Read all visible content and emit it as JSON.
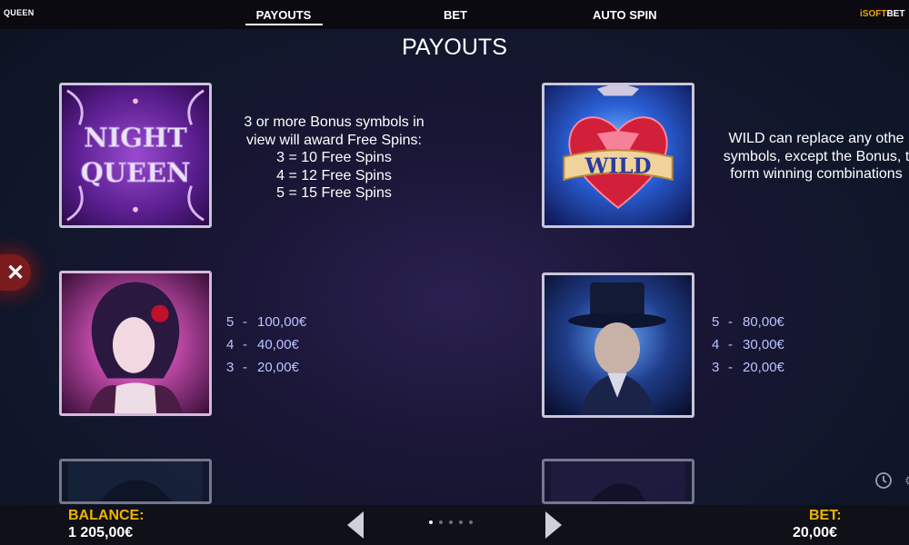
{
  "header": {
    "game_title": "QUEEN",
    "tabs": [
      {
        "label": "PAYOUTS",
        "active": true
      },
      {
        "label": "BET",
        "active": false
      },
      {
        "label": "AUTO SPIN",
        "active": false
      }
    ],
    "brand": {
      "prefix": "i",
      "mid": "SOFT",
      "suffix": "BET"
    }
  },
  "page_title": "PAYOUTS",
  "bonus": {
    "logo_line1": "NIGHT",
    "logo_line2": "QUEEN",
    "lines": [
      "3 or more Bonus symbols in",
      "view will award Free Spins:",
      "3 = 10 Free Spins",
      "4 = 12 Free Spins",
      "5 = 15 Free Spins"
    ]
  },
  "wild": {
    "banner_text": "WILD",
    "lines": [
      "WILD can replace any othe",
      "symbols, except the Bonus, t",
      "form winning combinations"
    ]
  },
  "symbol_queen": {
    "payouts": [
      {
        "count": "5",
        "amount": "100,00€"
      },
      {
        "count": "4",
        "amount": "40,00€"
      },
      {
        "count": "3",
        "amount": "20,00€"
      }
    ]
  },
  "symbol_gentleman": {
    "payouts": [
      {
        "count": "5",
        "amount": "80,00€"
      },
      {
        "count": "4",
        "amount": "30,00€"
      },
      {
        "count": "3",
        "amount": "20,00€"
      }
    ]
  },
  "close_icon": "close-icon",
  "footer": {
    "balance_label": "BALANCE:",
    "balance_value": "1 205,00€",
    "bet_label": "BET:",
    "bet_value": "20,00€",
    "page_dots": 5,
    "active_dot": 0
  },
  "colors": {
    "accent": "#f0b400",
    "payout_text": "#b9c3ff",
    "close_bg": "#7a1b1e"
  }
}
